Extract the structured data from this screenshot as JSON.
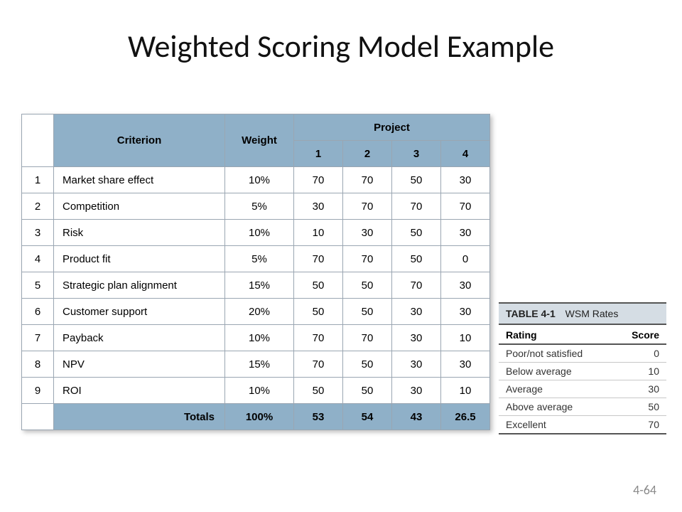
{
  "slide": {
    "title": "Weighted Scoring Model Example",
    "page_number": "4-64"
  },
  "wsm_table": {
    "headers": {
      "criterion": "Criterion",
      "weight": "Weight",
      "project": "Project",
      "p1": "1",
      "p2": "2",
      "p3": "3",
      "p4": "4"
    },
    "rows": [
      {
        "idx": "1",
        "criterion": "Market share effect",
        "weight": "10%",
        "p1": "70",
        "p2": "70",
        "p3": "50",
        "p4": "30"
      },
      {
        "idx": "2",
        "criterion": "Competition",
        "weight": "5%",
        "p1": "30",
        "p2": "70",
        "p3": "70",
        "p4": "70"
      },
      {
        "idx": "3",
        "criterion": "Risk",
        "weight": "10%",
        "p1": "10",
        "p2": "30",
        "p3": "50",
        "p4": "30"
      },
      {
        "idx": "4",
        "criterion": "Product fit",
        "weight": "5%",
        "p1": "70",
        "p2": "70",
        "p3": "50",
        "p4": "0"
      },
      {
        "idx": "5",
        "criterion": "Strategic plan alignment",
        "weight": "15%",
        "p1": "50",
        "p2": "50",
        "p3": "70",
        "p4": "30"
      },
      {
        "idx": "6",
        "criterion": "Customer support",
        "weight": "20%",
        "p1": "50",
        "p2": "50",
        "p3": "30",
        "p4": "30"
      },
      {
        "idx": "7",
        "criterion": "Payback",
        "weight": "10%",
        "p1": "70",
        "p2": "70",
        "p3": "30",
        "p4": "10"
      },
      {
        "idx": "8",
        "criterion": "NPV",
        "weight": "15%",
        "p1": "70",
        "p2": "50",
        "p3": "30",
        "p4": "30"
      },
      {
        "idx": "9",
        "criterion": "ROI",
        "weight": "10%",
        "p1": "50",
        "p2": "50",
        "p3": "30",
        "p4": "10"
      }
    ],
    "totals": {
      "label": "Totals",
      "weight": "100%",
      "p1": "53",
      "p2": "54",
      "p3": "43",
      "p4": "26.5"
    }
  },
  "rates_table": {
    "table_number": "TABLE 4-1",
    "table_name": "WSM Rates",
    "headers": {
      "rating": "Rating",
      "score": "Score"
    },
    "rows": [
      {
        "rating": "Poor/not satisfied",
        "score": "0"
      },
      {
        "rating": "Below average",
        "score": "10"
      },
      {
        "rating": "Average",
        "score": "30"
      },
      {
        "rating": "Above average",
        "score": "50"
      },
      {
        "rating": "Excellent",
        "score": "70"
      }
    ]
  },
  "chart_data": {
    "type": "table",
    "title": "Weighted Scoring Model Example",
    "criteria": [
      "Market share effect",
      "Competition",
      "Risk",
      "Product fit",
      "Strategic plan alignment",
      "Customer support",
      "Payback",
      "NPV",
      "ROI"
    ],
    "weights_percent": [
      10,
      5,
      10,
      5,
      15,
      20,
      10,
      15,
      10
    ],
    "projects": {
      "1": [
        70,
        30,
        10,
        70,
        50,
        50,
        70,
        70,
        50
      ],
      "2": [
        70,
        70,
        30,
        70,
        50,
        50,
        70,
        50,
        50
      ],
      "3": [
        50,
        70,
        50,
        50,
        70,
        30,
        30,
        30,
        30
      ],
      "4": [
        30,
        70,
        30,
        0,
        30,
        30,
        10,
        30,
        10
      ]
    },
    "totals": {
      "1": 53,
      "2": 54,
      "3": 43,
      "4": 26.5
    },
    "rating_scale": {
      "Poor/not satisfied": 0,
      "Below average": 10,
      "Average": 30,
      "Above average": 50,
      "Excellent": 70
    }
  }
}
